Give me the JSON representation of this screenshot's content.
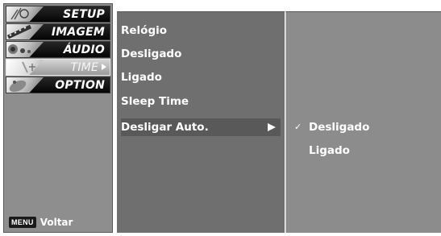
{
  "main_menu": {
    "items": [
      {
        "label": "SETUP",
        "icon": "satellite-dish-icon"
      },
      {
        "label": "IMAGEM",
        "icon": "film-strip-icon"
      },
      {
        "label": "ÁUDIO",
        "icon": "speaker-icon"
      },
      {
        "label": "TIME",
        "icon": "clock-icon",
        "selected": true
      },
      {
        "label": "OPTION",
        "icon": "option-gear-icon"
      }
    ],
    "hint": {
      "key": "MENU",
      "text": "Voltar"
    }
  },
  "submenu": {
    "items": [
      {
        "label": "Relógio"
      },
      {
        "label": "Desligado"
      },
      {
        "label": "Ligado"
      },
      {
        "label": "Sleep Time"
      },
      {
        "label": "Desligar Auto.",
        "highlighted": true,
        "has_submenu": true
      }
    ]
  },
  "options": {
    "items": [
      {
        "label": "Desligado",
        "checked": true,
        "check_glyph": "✓"
      },
      {
        "label": "Ligado",
        "checked": false,
        "check_glyph": ""
      }
    ]
  },
  "colors": {
    "left_panel_bg": "#8e8e8e",
    "submenu_bg": "#6f6f6f",
    "options_bg": "#8c8c8c",
    "highlight_bg": "#595959",
    "text": "#ffffff"
  }
}
